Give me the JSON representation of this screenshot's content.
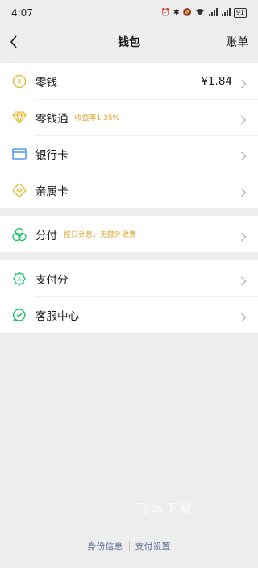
{
  "status_bar": {
    "time": "4:07",
    "battery": "91"
  },
  "nav": {
    "title": "钱包",
    "right_label": "账单"
  },
  "groups": [
    {
      "items": [
        {
          "label": "零钱",
          "value": "¥1.84",
          "icon": "yuan-coin-icon"
        },
        {
          "label": "零钱通",
          "sub": "收益率1.35%",
          "icon": "diamond-icon"
        },
        {
          "label": "银行卡",
          "icon": "bank-card-icon"
        },
        {
          "label": "亲属卡",
          "icon": "family-card-icon"
        }
      ]
    },
    {
      "items": [
        {
          "label": "分付",
          "sub": "按日计息，无额外收费",
          "icon": "fenfu-icon"
        }
      ]
    },
    {
      "items": [
        {
          "label": "支付分",
          "icon": "pay-score-icon"
        },
        {
          "label": "客服中心",
          "icon": "customer-service-icon"
        }
      ]
    }
  ],
  "watermark": "飞鸟下载",
  "footer": {
    "identity_label": "身份信息",
    "settings_label": "支付设置"
  },
  "colors": {
    "accent_green": "#07c160",
    "gold": "#e0a22a",
    "link_blue": "#576b95",
    "background": "#ededed"
  }
}
